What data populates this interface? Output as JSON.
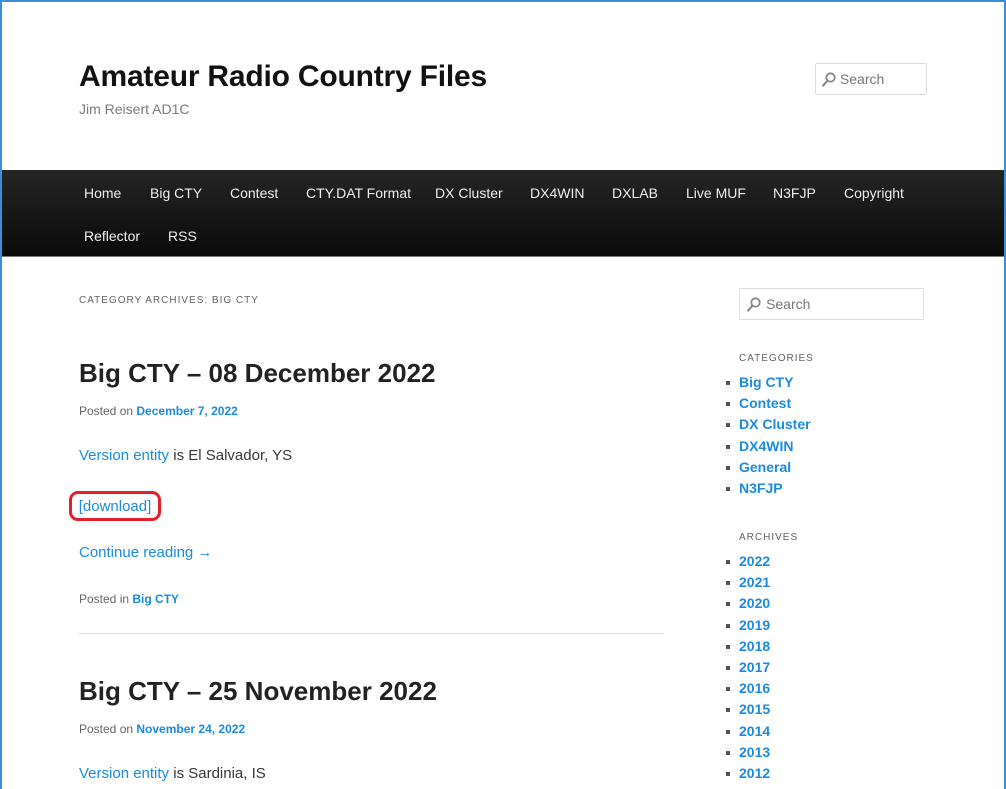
{
  "site": {
    "title": "Amateur Radio Country Files",
    "description": "Jim Reisert AD1C"
  },
  "search": {
    "placeholder": "Search"
  },
  "nav": {
    "items": [
      "Home",
      "Big CTY",
      "Contest",
      "CTY.DAT Format",
      "DX Cluster",
      "DX4WIN",
      "DXLAB",
      "Live MUF",
      "N3FJP",
      "Copyright",
      "Reflector",
      "RSS"
    ]
  },
  "archive": {
    "title": "Category Archives: Big CTY"
  },
  "posts": [
    {
      "title": "Big CTY – 08 December 2022",
      "posted_on_label": "Posted on",
      "date": "December 7, 2022",
      "version_link": "Version entity",
      "version_text": "is El Salvador, YS",
      "download": "[download]",
      "continue": "Continue reading →",
      "posted_in_label": "Posted in",
      "category": "Big CTY"
    },
    {
      "title": "Big CTY – 25 November 2022",
      "posted_on_label": "Posted on",
      "date": "November 24, 2022",
      "version_link": "Version entity",
      "version_text": "is Sardinia, IS"
    }
  ],
  "sidebar": {
    "categories_title": "Categories",
    "categories": [
      "Big CTY",
      "Contest",
      "DX Cluster",
      "DX4WIN",
      "General",
      "N3FJP"
    ],
    "archives_title": "Archives",
    "archives": [
      "2022",
      "2021",
      "2020",
      "2019",
      "2018",
      "2017",
      "2016",
      "2015",
      "2014",
      "2013",
      "2012"
    ]
  },
  "colors": {
    "link": "#1b8be0",
    "nav_bg": "#0a0a0a",
    "highlight_border": "#e0202a",
    "frame_border": "#3b8fd6"
  },
  "icons": {
    "search": "magnifier-icon",
    "arrow": "right-arrow"
  }
}
